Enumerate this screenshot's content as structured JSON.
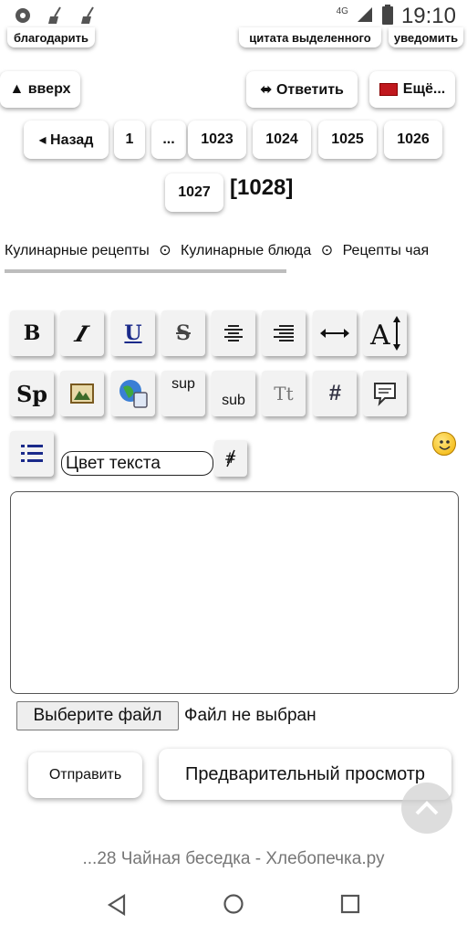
{
  "status_bar": {
    "time": "19:10",
    "network": "4G"
  },
  "top_actions": {
    "thank_label": "благодарить",
    "quote_label": "цитата выделенного",
    "notify_label": "уведомить",
    "up_label": "▲ вверх",
    "reply_label": "⬌ Ответить",
    "more_label": "Ещё..."
  },
  "pagination": {
    "back_label": "◂ Назад",
    "pages": [
      "1",
      "...",
      "1023",
      "1024",
      "1025",
      "1026",
      "1027"
    ],
    "current": "[1028]"
  },
  "breadcrumbs": [
    "Кулинарные рецепты",
    "Кулинарные блюда",
    "Рецепты чая"
  ],
  "breadcrumb_separator": "⊙",
  "toolbar": {
    "bold": "B",
    "italic": "I",
    "underline": "U",
    "strike": "S",
    "sp": "Sp",
    "sup": "sup",
    "sub": "sub",
    "tt": "Tt",
    "hash": "#"
  },
  "color_select": {
    "value": "Цвет текста"
  },
  "file_input": {
    "button_label": "Выберите файл",
    "status": "Файл не выбран"
  },
  "form_buttons": {
    "submit_label": "Отправить",
    "preview_label": "Предварительный просмотр"
  },
  "page_title": "...28 Чайная беседка - Хлебопечка.ру"
}
